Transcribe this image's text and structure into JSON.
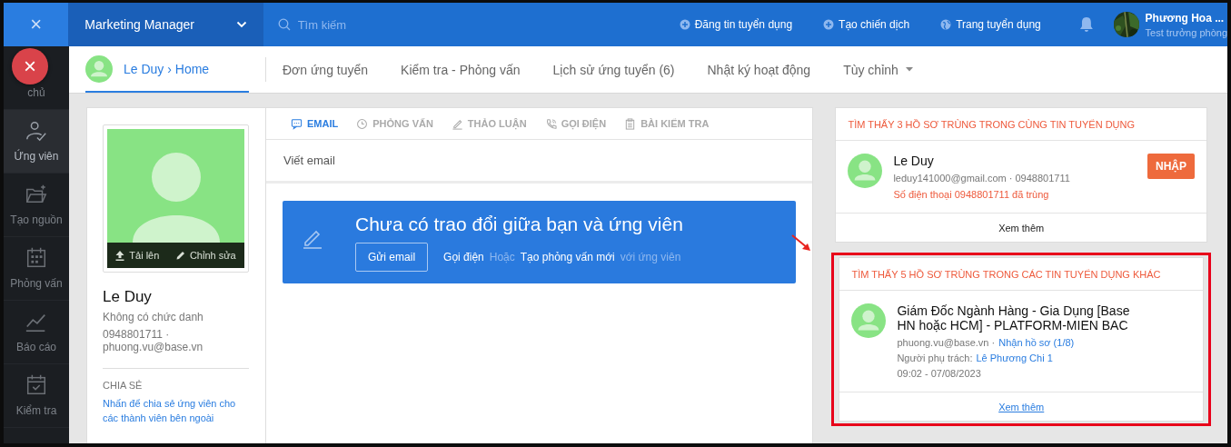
{
  "topbar": {
    "close": "×",
    "workspace": "Marketing Manager",
    "search": {
      "placeholder": "Tìm kiếm"
    },
    "actions": [
      {
        "label": "Đăng tin tuyển dụng"
      },
      {
        "label": "Tạo chiến dịch"
      },
      {
        "label": "Trang tuyển dụng"
      }
    ],
    "user": {
      "name": "Phương Hoa ...",
      "role": "Test trưởng phòng"
    }
  },
  "sidebar": {
    "items": [
      {
        "label": "chủ",
        "selected": false
      },
      {
        "label": "Ứng viên",
        "selected": true
      },
      {
        "label": "Tạo nguồn",
        "selected": false
      },
      {
        "label": "Phỏng vấn",
        "selected": false
      },
      {
        "label": "Báo cáo",
        "selected": false
      },
      {
        "label": "Kiểm tra",
        "selected": false
      }
    ]
  },
  "floating_close": "×",
  "subnav": {
    "breadcrumb": {
      "name": "Le Duy",
      "separator": "›",
      "page": "Home"
    },
    "tabs": [
      {
        "label": "Đơn ứng tuyển"
      },
      {
        "label": "Kiểm tra - Phỏng vấn"
      },
      {
        "label": "Lịch sử ứng tuyển (6)"
      },
      {
        "label": "Nhật ký hoạt động"
      }
    ],
    "custom": "Tùy chỉnh"
  },
  "profile": {
    "upload": "Tải lên",
    "edit": "Chỉnh sửa",
    "name": "Le Duy",
    "title": "Không có chức danh",
    "contact": "0948801711 · phuong.vu@base.vn",
    "share": {
      "heading": "CHIA SẺ",
      "link": "Nhấn để chia sẻ ứng viên cho các thành viên bên ngoài"
    }
  },
  "activity": {
    "tabs": [
      {
        "label": "EMAIL",
        "selected": true
      },
      {
        "label": "PHỎNG VẤN",
        "selected": false
      },
      {
        "label": "THẢO LUẬN",
        "selected": false
      },
      {
        "label": "GỌI ĐIỆN",
        "selected": false
      },
      {
        "label": "BÀI KIỂM TRA",
        "selected": false
      }
    ],
    "compose": "Viết email",
    "empty": {
      "title": "Chưa có trao đổi giữa bạn và ứng viên",
      "button": "Gửi email",
      "call": "Gọi điện",
      "or": "Hoặc",
      "create": "Tạo phỏng vấn mới",
      "tail": "với ứng viên"
    }
  },
  "duplicates": [
    {
      "heading": "TÌM THẤY 3 HỒ SƠ TRÙNG TRONG CÙNG TIN TUYỂN DỤNG",
      "highlighted": false,
      "items": [
        {
          "kind": "candidate",
          "name": "Le Duy",
          "contact": "leduy141000@gmail.com · 0948801711",
          "warning": "Số điện thoại 0948801711 đã trùng",
          "action": "NHẬP"
        }
      ],
      "more": {
        "label": "Xem thêm",
        "link": false
      }
    },
    {
      "heading": "TÌM THẤY 5 HỒ SƠ TRÙNG TRONG CÁC TIN TUYỂN DỤNG KHÁC",
      "highlighted": true,
      "items": [
        {
          "kind": "job",
          "title": "Giám Đốc Ngành Hàng - Gia Dụng [Base HN hoặc HCM] - PLATFORM-MIEN BAC",
          "email": "phuong.vu@base.vn ·",
          "stage": "Nhận hồ sơ (1/8)",
          "owner_label": "Người phụ trách:",
          "owner": "Lê Phương Chi 1",
          "time": "09:02 - 07/08/2023"
        }
      ],
      "more": {
        "label": "Xem thêm",
        "link": true
      }
    }
  ]
}
